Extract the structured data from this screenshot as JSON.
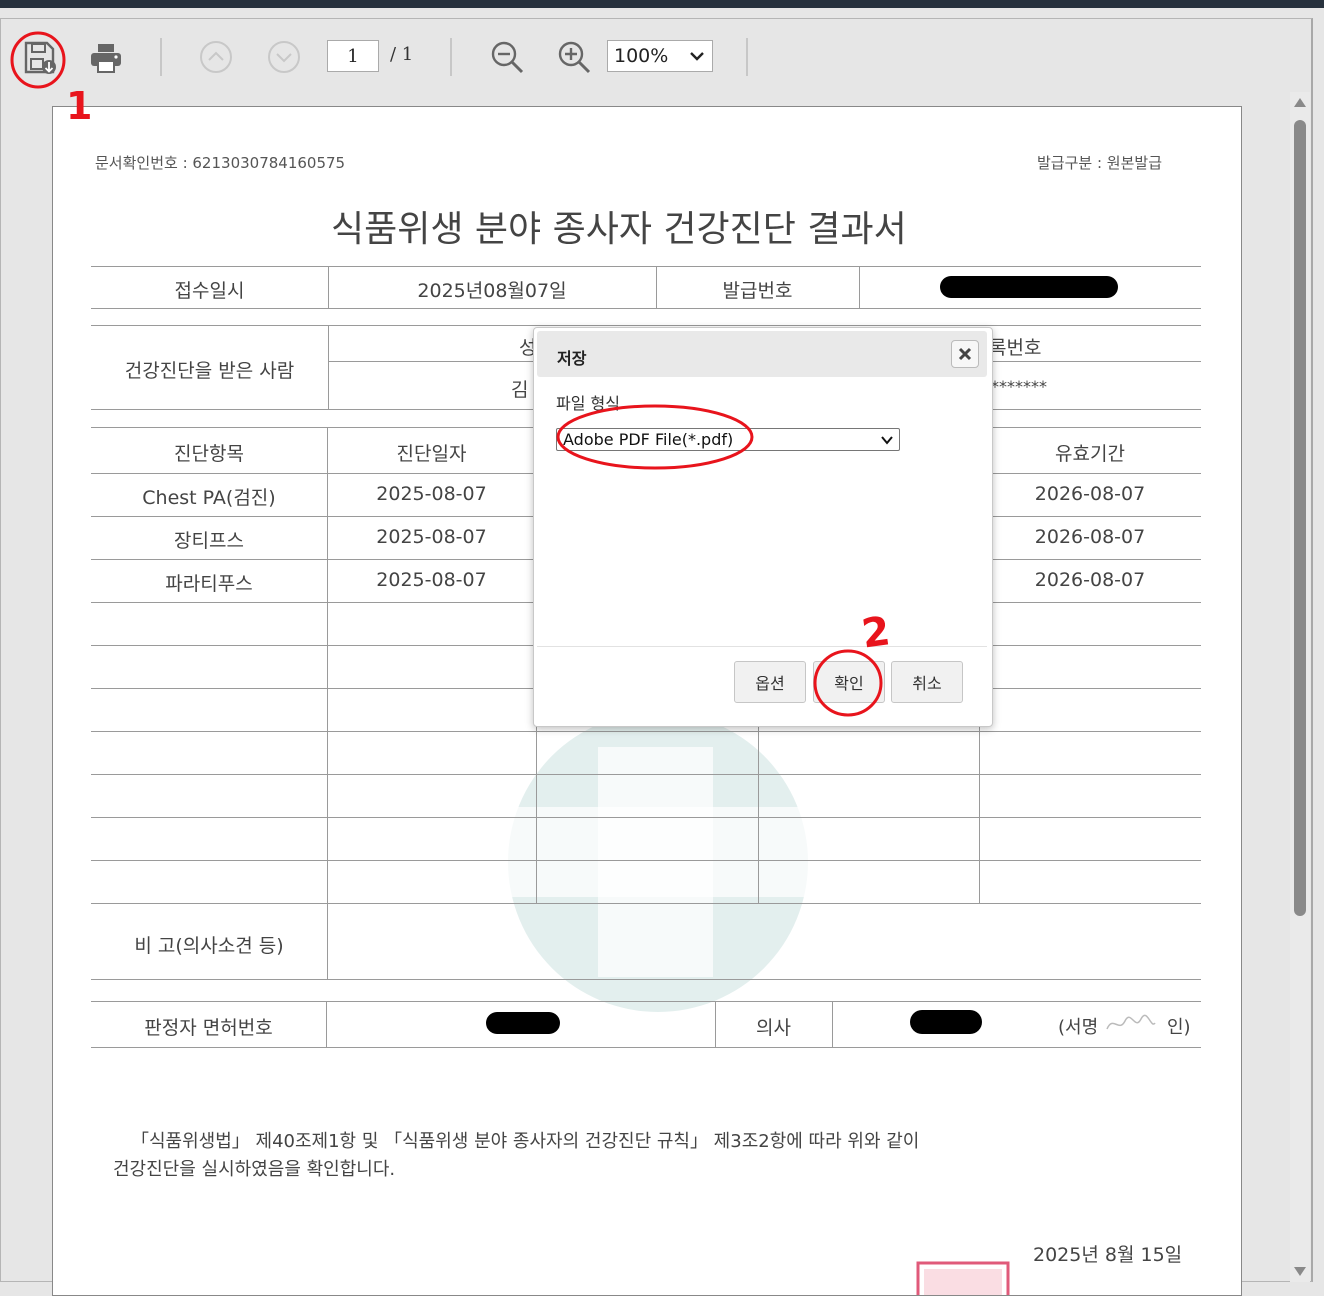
{
  "toolbar": {
    "save_icon": "save-download-icon",
    "print_icon": "print-icon",
    "page_current": "1",
    "page_total": "/ 1",
    "zoom_value": "100%"
  },
  "annotations": {
    "step1": "1",
    "step2": "2",
    "color": "#e8141c"
  },
  "document": {
    "confirm_no_label": "문서확인번호 : 6213030784160575",
    "issue_type_label": "발급구분 : 원본발급",
    "title": "식품위생 분야 종사자 건강진단 결과서",
    "receipt_label": "접수일시",
    "receipt_value": "2025년08월07일",
    "issue_no_label": "발급번호",
    "person_label": "건강진단을 받은 사람",
    "name_partial": "성",
    "name_value_partial": "김",
    "id_label_partial": "록번호",
    "id_value_partial": "*******",
    "headers": [
      "진단항목",
      "진단일자",
      "유효기간"
    ],
    "rows": [
      {
        "item": "Chest PA(검진)",
        "date": "2025-08-07",
        "expiry": "2026-08-07"
      },
      {
        "item": "장티프스",
        "date": "2025-08-07",
        "expiry": "2026-08-07"
      },
      {
        "item": "파라티푸스",
        "date": "2025-08-07",
        "expiry": "2026-08-07"
      }
    ],
    "remarks_label": "비 고(의사소견 등)",
    "license_label": "판정자 면허번호",
    "doctor_label": "의사",
    "sign_prefix": "(서명",
    "sign_suffix": "인)",
    "statement_line1": "「식품위생법」 제40조제1항 및 「식품위생 분야 종사자의 건강진단 규칙」 제3조2항에 따라 위와 같이",
    "statement_line2": "건강진단을 실시하였음을 확인합니다.",
    "date_line": "2025년 8월 15일"
  },
  "dialog": {
    "title": "저장",
    "format_label": "파일 형식",
    "format_value": "Adobe PDF File(*.pdf)",
    "options_button": "옵션",
    "ok_button": "확인",
    "cancel_button": "취소"
  }
}
